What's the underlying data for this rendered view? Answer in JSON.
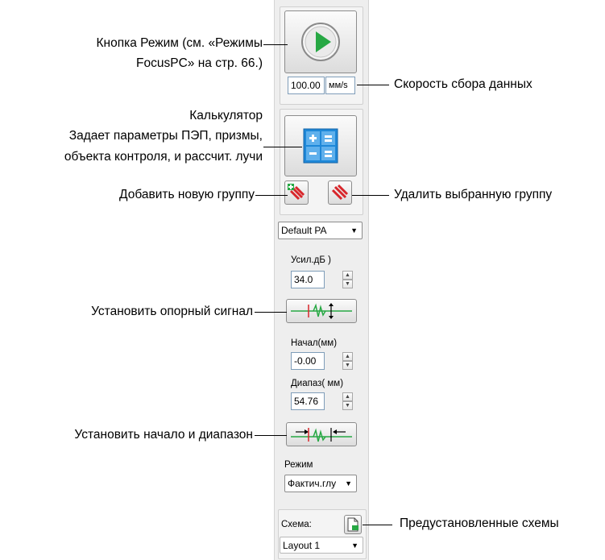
{
  "panel": {
    "speed_value": "100.00",
    "speed_unit": "мм/s",
    "setup_combo": "Default PA",
    "gain_label": "Усил.дБ )",
    "gain_value": "34.0",
    "start_label": "Начал(мм)",
    "start_value": "-0.00",
    "range_label": "Диапаз( мм)",
    "range_value": "54.76",
    "mode_label": "Режим",
    "mode_value": "Фактич.глу",
    "layout_label": "Схема:",
    "layout_value": "Layout 1",
    "spin_up": "▲",
    "spin_down": "▼",
    "combo_arrow": "▼"
  },
  "annotations": {
    "mode_button": [
      "Кнопка Режим (см. «Режимы",
      "FocusPC» на стр. 66.)"
    ],
    "speed": "Скорость сбора данных",
    "calculator": [
      "Калькулятор",
      "Задает параметры ПЭП, призмы,",
      "объекта контроля, и рассчит. лучи"
    ],
    "add_group": "Добавить новую группу",
    "delete_group": "Удалить выбранную группу",
    "reference": "Установить опорный сигнал",
    "start_range": "Установить начало и диапазон",
    "preset_layouts": "Предустановленные схемы"
  },
  "colors": {
    "play_green": "#27a844",
    "calc_blue": "#1e88d8",
    "group_red": "#d8262b"
  }
}
